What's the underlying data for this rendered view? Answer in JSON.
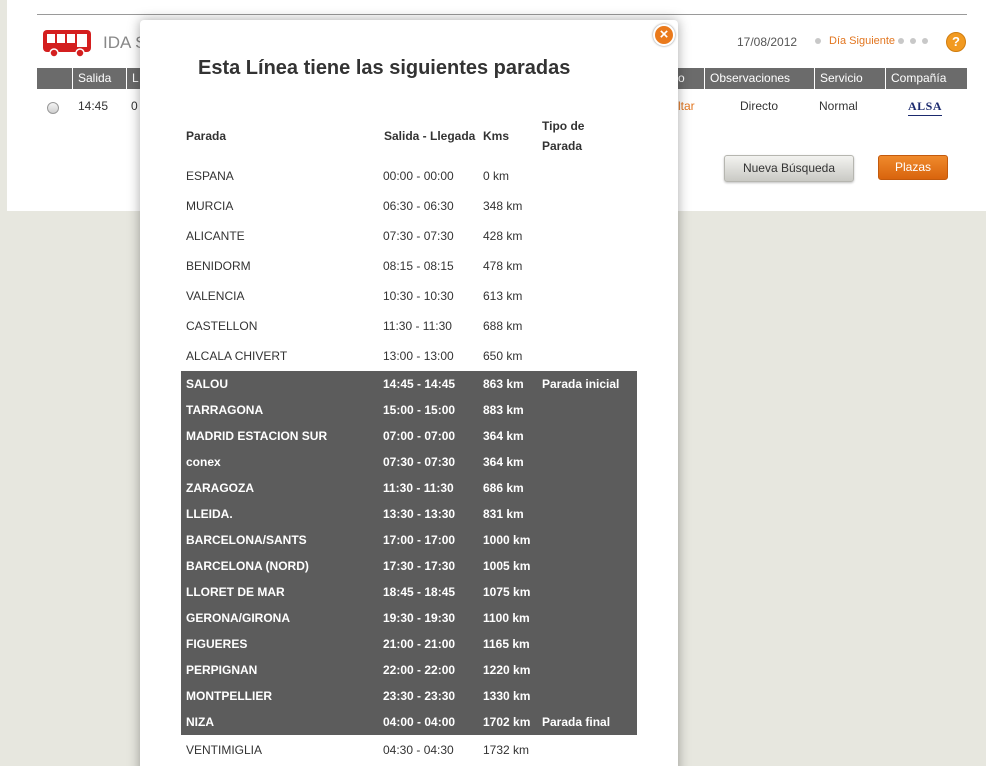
{
  "background": {
    "title": "IDA S",
    "date": "17/08/2012",
    "next_day_label": "Día Siguiente",
    "help_symbol": "?",
    "columns": [
      "Salida",
      "L",
      "o",
      "Observaciones",
      "Servicio",
      "Compañía"
    ],
    "row": {
      "salida": "14:45",
      "partial": "0",
      "link_partial": "ltar",
      "observaciones": "Directo",
      "servicio": "Normal",
      "company_logo": "ALSA"
    },
    "buttons": {
      "new_search": "Nueva Búsqueda",
      "plazas": "Plazas"
    },
    "accent_color": "#e27620"
  },
  "modal": {
    "title": "Esta Línea tiene las siguientes paradas",
    "close_symbol": "×",
    "headers": {
      "stop": "Parada",
      "time": "Salida - Llegada",
      "kms": "Kms",
      "type_line1": "Tipo de",
      "type_line2": "Parada"
    },
    "highlight_color": "#5c5c5c",
    "stops": [
      {
        "name": "ESPANA",
        "time": "00:00 - 00:00",
        "km": "0 km",
        "type": "",
        "hl": false
      },
      {
        "name": "MURCIA",
        "time": "06:30 - 06:30",
        "km": "348 km",
        "type": "",
        "hl": false
      },
      {
        "name": "ALICANTE",
        "time": "07:30 - 07:30",
        "km": "428 km",
        "type": "",
        "hl": false
      },
      {
        "name": "BENIDORM",
        "time": "08:15 - 08:15",
        "km": "478 km",
        "type": "",
        "hl": false
      },
      {
        "name": "VALENCIA",
        "time": "10:30 - 10:30",
        "km": "613 km",
        "type": "",
        "hl": false
      },
      {
        "name": "CASTELLON",
        "time": "11:30 - 11:30",
        "km": "688 km",
        "type": "",
        "hl": false
      },
      {
        "name": "ALCALA CHIVERT",
        "time": "13:00 - 13:00",
        "km": "650 km",
        "type": "",
        "hl": false
      },
      {
        "name": "SALOU",
        "time": "14:45 - 14:45",
        "km": "863 km",
        "type": "Parada inicial",
        "hl": true
      },
      {
        "name": "TARRAGONA",
        "time": "15:00 - 15:00",
        "km": "883 km",
        "type": "",
        "hl": true
      },
      {
        "name": "MADRID ESTACION SUR",
        "time": "07:00 - 07:00",
        "km": "364 km",
        "type": "",
        "hl": true
      },
      {
        "name": "conex",
        "time": "07:30 - 07:30",
        "km": "364 km",
        "type": "",
        "hl": true
      },
      {
        "name": "ZARAGOZA",
        "time": "11:30 - 11:30",
        "km": "686 km",
        "type": "",
        "hl": true
      },
      {
        "name": "LLEIDA.",
        "time": "13:30 - 13:30",
        "km": "831 km",
        "type": "",
        "hl": true
      },
      {
        "name": "BARCELONA/SANTS",
        "time": "17:00 - 17:00",
        "km": "1000 km",
        "type": "",
        "hl": true
      },
      {
        "name": "BARCELONA (NORD)",
        "time": "17:30 - 17:30",
        "km": "1005 km",
        "type": "",
        "hl": true
      },
      {
        "name": "LLORET DE MAR",
        "time": "18:45 - 18:45",
        "km": "1075 km",
        "type": "",
        "hl": true
      },
      {
        "name": "GERONA/GIRONA",
        "time": "19:30 - 19:30",
        "km": "1100 km",
        "type": "",
        "hl": true
      },
      {
        "name": "FIGUERES",
        "time": "21:00 - 21:00",
        "km": "1165 km",
        "type": "",
        "hl": true
      },
      {
        "name": "PERPIGNAN",
        "time": "22:00 - 22:00",
        "km": "1220 km",
        "type": "",
        "hl": true
      },
      {
        "name": "MONTPELLIER",
        "time": "23:30 - 23:30",
        "km": "1330 km",
        "type": "",
        "hl": true
      },
      {
        "name": "NIZA",
        "time": "04:00 - 04:00",
        "km": "1702 km",
        "type": "Parada final",
        "hl": true
      },
      {
        "name": "VENTIMIGLIA",
        "time": "04:30 - 04:30",
        "km": "1732 km",
        "type": "",
        "hl": false
      }
    ]
  }
}
